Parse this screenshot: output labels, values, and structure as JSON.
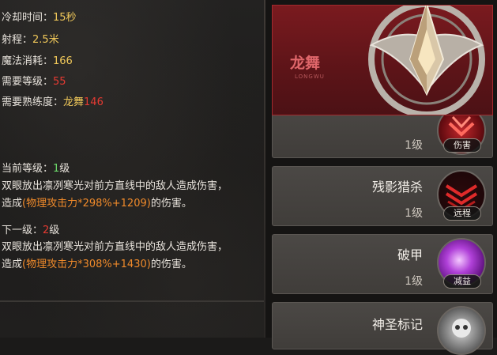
{
  "detail": {
    "cooldown_label": "冷却时间：",
    "cooldown_value": "15秒",
    "range_label": "射程：",
    "range_value": "2.5米",
    "mana_label": "魔法消耗：",
    "mana_value": "166",
    "req_level_label": "需要等级：",
    "req_level_value": "55",
    "req_skill_label": "需要熟练度：",
    "req_skill_name": "龙舞",
    "req_skill_value": "146",
    "current_label": "当前等级：",
    "current_value": "1",
    "current_unit": "级",
    "current_desc": "双眼放出凛冽寒光对前方直线中的敌人造成伤害，",
    "current_effect_prefix": "造成",
    "current_effect_formula": "(物理攻击力*298%+1209)",
    "current_effect_suffix": "的伤害。",
    "next_label": "下一级：",
    "next_value": "2",
    "next_unit": "级",
    "next_desc": "双眼放出凛冽寒光对前方直线中的敌人造成伤害，",
    "next_effect_prefix": "造成",
    "next_effect_formula": "(物理攻击力*308%+1430)",
    "next_effect_suffix": "的伤害。"
  },
  "header": {
    "name": "龙舞",
    "subtitle": "LONGWU"
  },
  "skills": [
    {
      "name": "",
      "level": "1级",
      "tag": "伤害",
      "icon": "claw-icon"
    },
    {
      "name": "残影猎杀",
      "level": "1级",
      "tag": "远程",
      "icon": "slash-icon"
    },
    {
      "name": "破甲",
      "level": "1级",
      "tag": "减益",
      "icon": "vortex-icon"
    },
    {
      "name": "神圣标记",
      "level": "",
      "tag": "",
      "icon": "skull-icon"
    }
  ],
  "colors": {
    "accent_red": "#e53a32",
    "accent_yellow": "#f0c85a",
    "accent_orange": "#f08a2a",
    "accent_green": "#6bd86a"
  }
}
